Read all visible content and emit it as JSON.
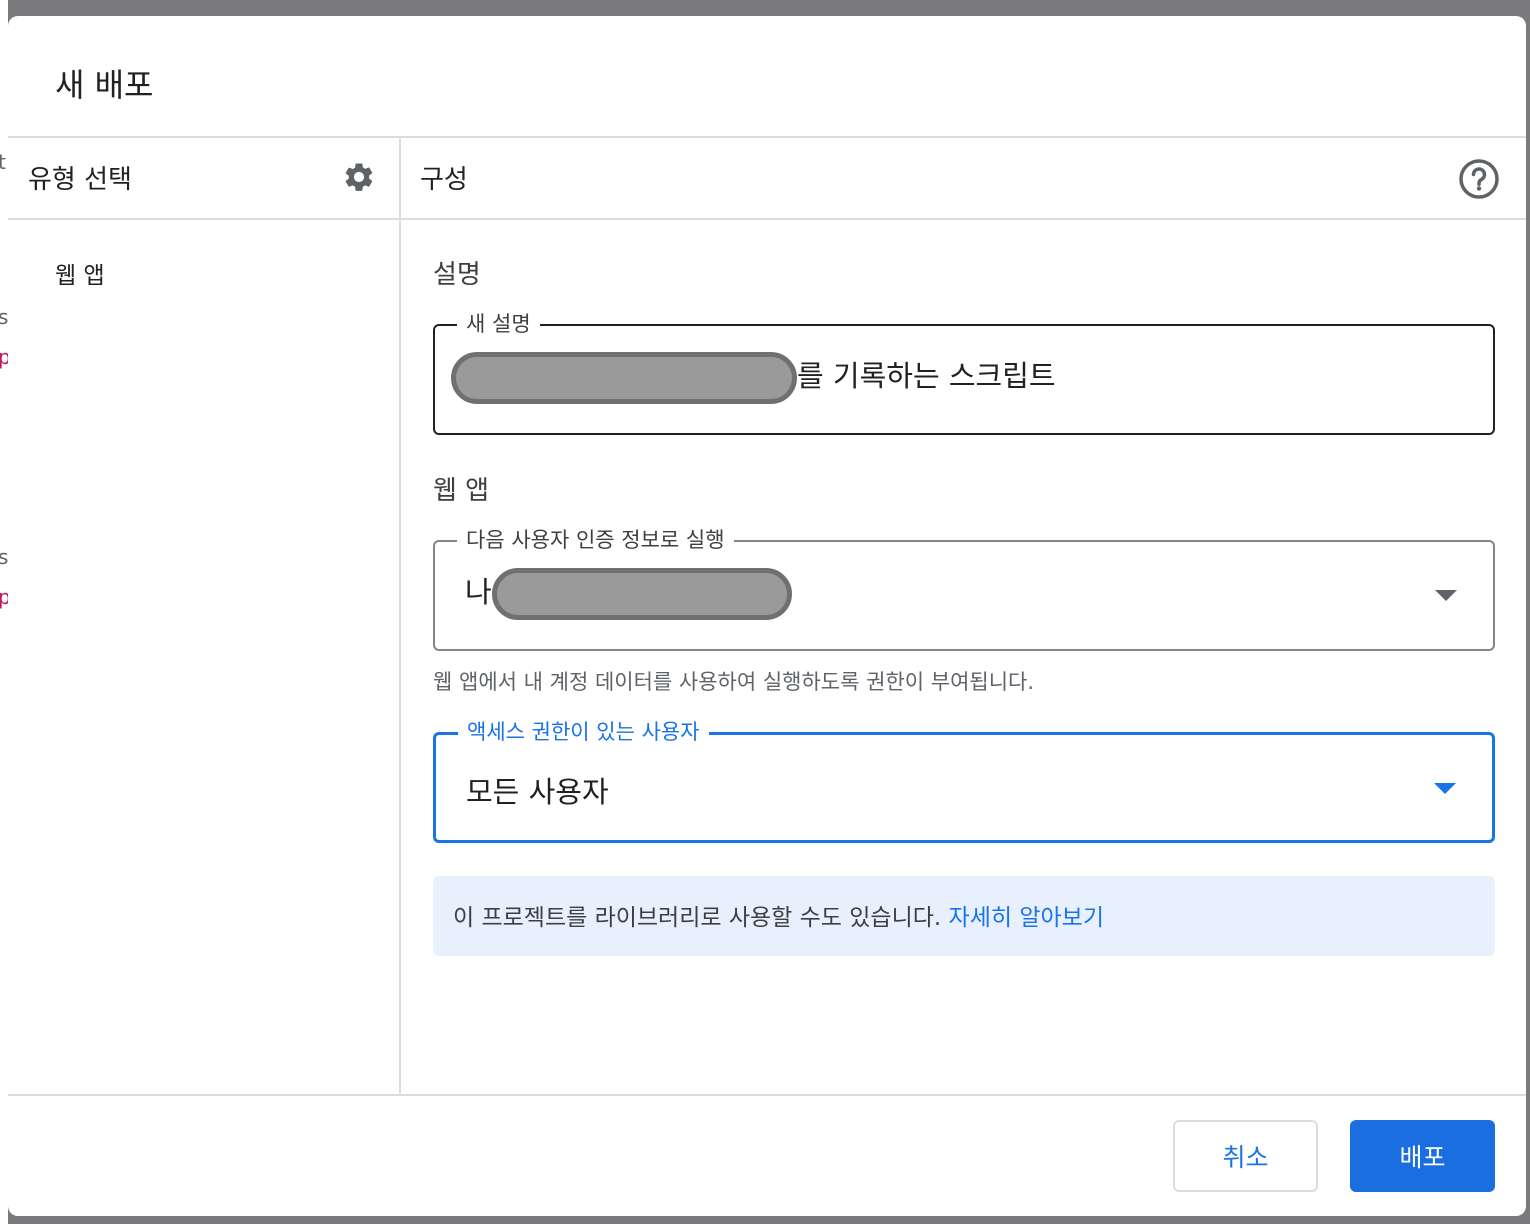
{
  "dialog": {
    "title": "새 배포"
  },
  "left_panel": {
    "heading": "유형 선택",
    "settings_icon": "gear-icon",
    "items": [
      {
        "label": "웹 앱"
      }
    ]
  },
  "right_panel": {
    "heading": "구성",
    "help_icon": "help-circle-icon",
    "description_section": {
      "label": "설명",
      "field_label": "새 설명",
      "value_suffix": "를 기록하는 스크립트"
    },
    "webapp_section": {
      "label": "웹 앱",
      "execute_as": {
        "label": "다음 사용자 인증 정보로 실행",
        "value_prefix": "나"
      },
      "helper_text": "웹 앱에서 내 계정 데이터를 사용하여 실행하도록 권한이 부여됩니다.",
      "access": {
        "label": "액세스 권한이 있는 사용자",
        "value": "모든 사용자"
      }
    },
    "notice": {
      "text": "이 프로젝트를 라이브러리로 사용할 수도 있습니다.",
      "link": "자세히 알아보기"
    }
  },
  "footer": {
    "cancel_label": "취소",
    "deploy_label": "배포"
  },
  "colors": {
    "accent": "#1a73e8",
    "notice_bg": "#e8f0fe",
    "backdrop": "#7a7a7c"
  }
}
